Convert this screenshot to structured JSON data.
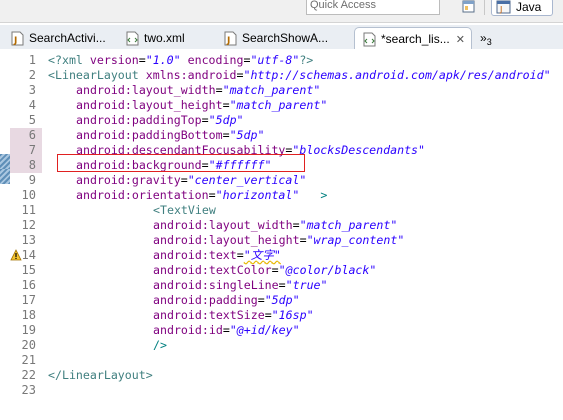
{
  "toolbar": {
    "quick_access_placeholder": "Quick Access",
    "perspective_label": "Java",
    "open_perspective_icon": "open-perspective-icon",
    "java_perspective_icon": "java-perspective-icon"
  },
  "tabs": [
    {
      "label": "SearchActivi...",
      "icon": "java-file-icon",
      "active": false
    },
    {
      "label": "two.xml",
      "icon": "xml-file-icon",
      "active": false
    },
    {
      "label": "SearchShowA...",
      "icon": "java-file-icon",
      "active": false
    },
    {
      "label": "*search_lis...",
      "icon": "xml-file-icon",
      "active": true,
      "close": "✕"
    }
  ],
  "overflow": {
    "chevron": "»",
    "count": "3"
  },
  "editor": {
    "lines": [
      {
        "n": "1"
      },
      {
        "n": "2"
      },
      {
        "n": "3"
      },
      {
        "n": "4"
      },
      {
        "n": "5"
      },
      {
        "n": "6"
      },
      {
        "n": "7"
      },
      {
        "n": "8"
      },
      {
        "n": "9"
      },
      {
        "n": "10"
      },
      {
        "n": "11"
      },
      {
        "n": "12"
      },
      {
        "n": "13"
      },
      {
        "n": "14"
      },
      {
        "n": "15"
      },
      {
        "n": "16"
      },
      {
        "n": "17"
      },
      {
        "n": "18"
      },
      {
        "n": "19"
      },
      {
        "n": "20"
      },
      {
        "n": "21"
      },
      {
        "n": "22"
      },
      {
        "n": "23"
      }
    ],
    "code": {
      "l1": {
        "pi_open": "<?xml",
        "a1": " version",
        "v1": "\"1.0\"",
        "a2": " encoding",
        "v2": "\"utf-8\"",
        "pi_close": "?>"
      },
      "l2": {
        "open": "<LinearLayout",
        "attr": " xmlns:android",
        "val": "\"http://schemas.android.com/apk/res/android\""
      },
      "l3": {
        "attr": "android:layout_width",
        "val": "\"match_parent\""
      },
      "l4": {
        "attr": "android:layout_height",
        "val": "\"match_parent\""
      },
      "l5": {
        "attr": "android:paddingTop",
        "val": "\"5dp\""
      },
      "l6": {
        "attr": "android:paddingBottom",
        "val": "\"5dp\""
      },
      "l7": {
        "attr": "android:descendantFocusability",
        "val": "\"blocksDescendants\""
      },
      "l8": {
        "attr": "android:background",
        "val": "\"#ffffff\""
      },
      "l9": {
        "attr": "android:gravity",
        "val": "\"center_vertical\""
      },
      "l10": {
        "attr": "android:orientation",
        "val": "\"horizontal\"",
        "close": ">"
      },
      "l11": {
        "open": "<TextView"
      },
      "l12": {
        "attr": "android:layout_width",
        "val": "\"match_parent\""
      },
      "l13": {
        "attr": "android:layout_height",
        "val": "\"wrap_content\""
      },
      "l14": {
        "attr": "android:text",
        "val": "\"文字\""
      },
      "l15": {
        "attr": "android:textColor",
        "val": "\"@color/black\""
      },
      "l16": {
        "attr": "android:singleLine",
        "val": "\"true\""
      },
      "l17": {
        "attr": "android:padding",
        "val": "\"5dp\""
      },
      "l18": {
        "attr": "android:textSize",
        "val": "\"16sp\""
      },
      "l19": {
        "attr": "android:id",
        "val": "\"@+id/key\""
      },
      "l20": {
        "close": "/>"
      },
      "l22": {
        "close": "</LinearLayout>"
      }
    },
    "warning_icon": "warning-icon",
    "change_marker": "quick-diff-marker"
  },
  "colors": {
    "attr": "#7f007f",
    "string": "#2a00ff",
    "tag": "#3f7f7f",
    "highlight_box": "#e02020"
  }
}
